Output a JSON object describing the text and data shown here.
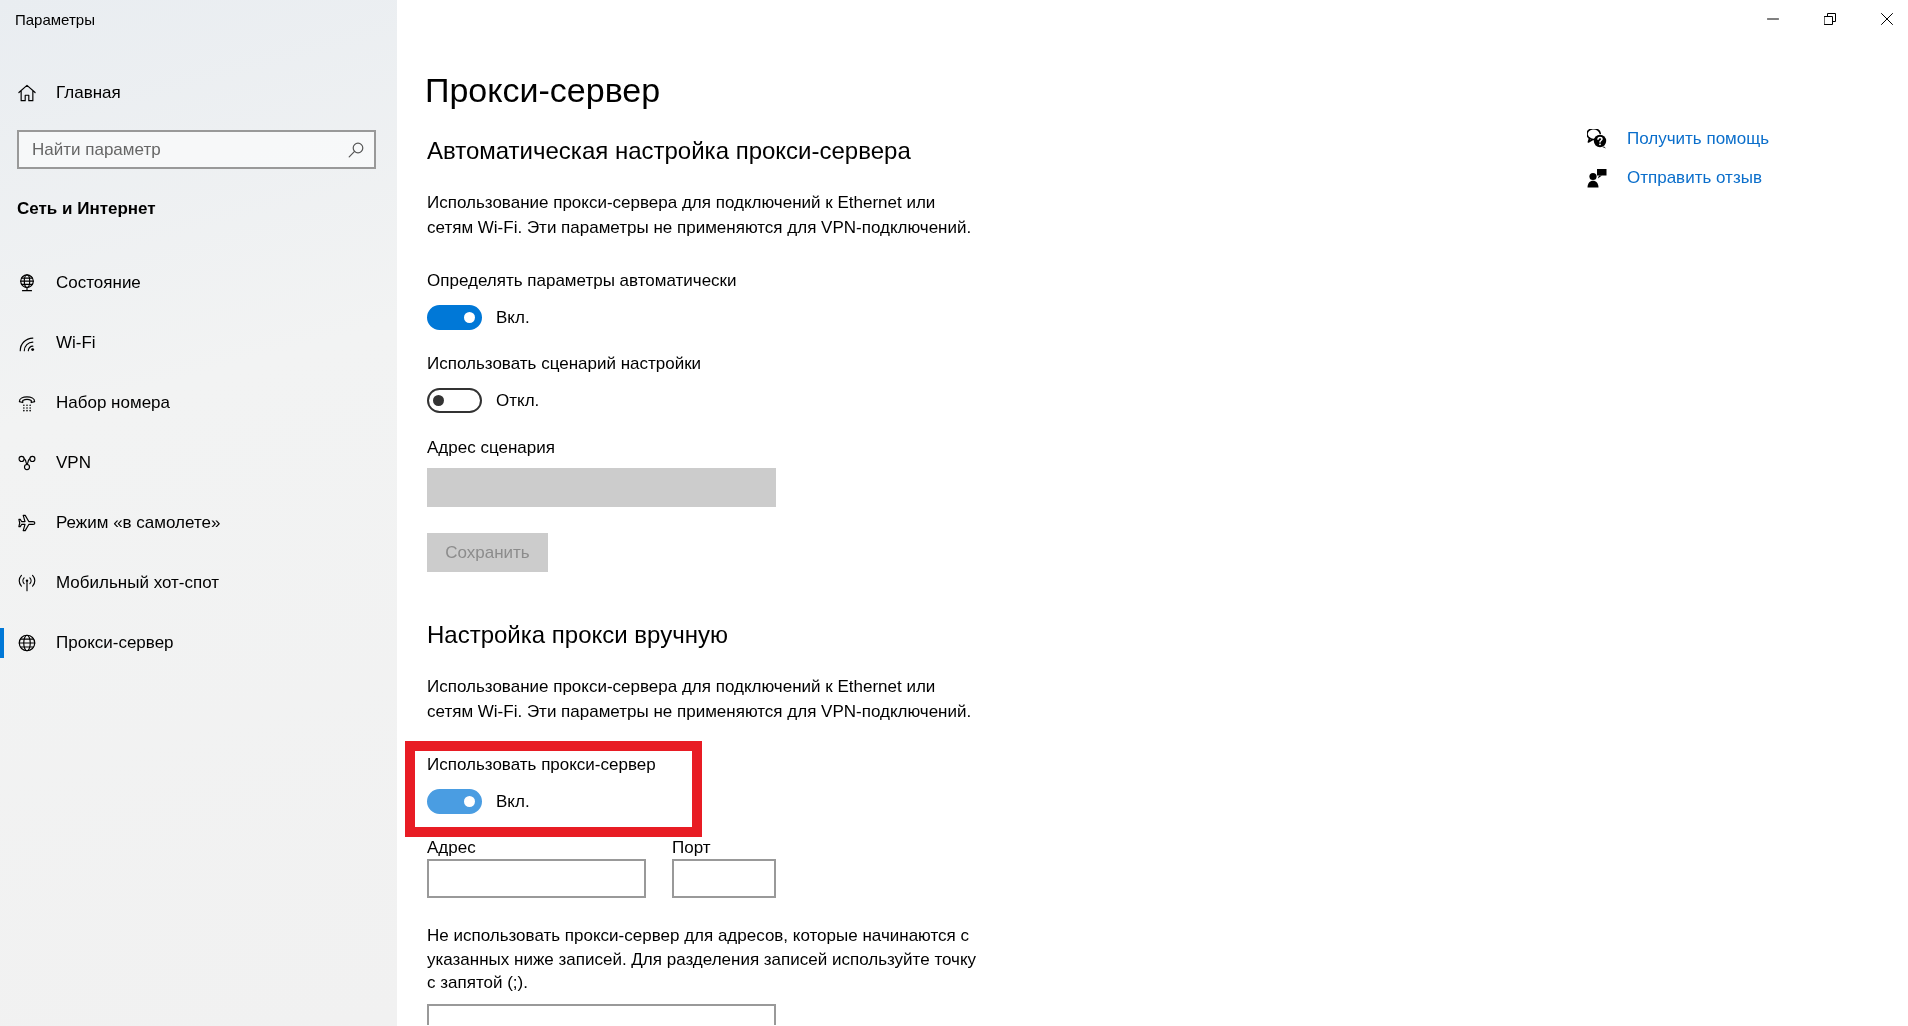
{
  "window": {
    "title": "Параметры"
  },
  "sidebar": {
    "home": {
      "label": "Главная"
    },
    "search": {
      "placeholder": "Найти параметр"
    },
    "section_title": "Сеть и Интернет",
    "items": [
      {
        "label": "Состояние",
        "selected": false
      },
      {
        "label": "Wi-Fi",
        "selected": false
      },
      {
        "label": "Набор номера",
        "selected": false
      },
      {
        "label": "VPN",
        "selected": false
      },
      {
        "label": "Режим «в самолете»",
        "selected": false
      },
      {
        "label": "Мобильный хот-спот",
        "selected": false
      },
      {
        "label": "Прокси-сервер",
        "selected": true
      }
    ]
  },
  "page": {
    "title": "Прокси-сервер",
    "sections": [
      {
        "heading": "Автоматическая настройка прокси-сервера",
        "description": "Использование прокси-сервера для подключений к Ethernet или сетям Wi-Fi. Эти параметры не применяются для VPN-подключений.",
        "toggles": [
          {
            "label": "Определять параметры автоматически",
            "on": true,
            "state_text": "Вкл.",
            "hovered": false,
            "highlighted": false
          },
          {
            "label": "Использовать сценарий настройки",
            "on": false,
            "state_text": "Откл.",
            "hovered": false,
            "highlighted": false
          }
        ],
        "script_address": {
          "label": "Адрес сценария",
          "disabled": true
        },
        "save_button": {
          "label": "Сохранить",
          "disabled": true
        }
      },
      {
        "heading": "Настройка прокси вручную",
        "description": "Использование прокси-сервера для подключений к Ethernet или сетям Wi-Fi. Эти параметры не применяются для VPN-подключений.",
        "toggles": [
          {
            "label": "Использовать прокси-сервер",
            "on": true,
            "state_text": "Вкл.",
            "hovered": true,
            "highlighted": true
          }
        ],
        "fields": [
          {
            "label": "Адрес",
            "disabled": false
          },
          {
            "label": "Порт",
            "disabled": false
          }
        ],
        "exceptions": {
          "description": "Не использовать прокси-сервер для адресов, которые начинаются с указанных ниже записей. Для разделения записей используйте точку с запятой (;).",
          "field": {
            "disabled": false
          }
        }
      }
    ]
  },
  "related": {
    "links": [
      {
        "label": "Получить помощь"
      },
      {
        "label": "Отправить отзыв"
      }
    ]
  }
}
